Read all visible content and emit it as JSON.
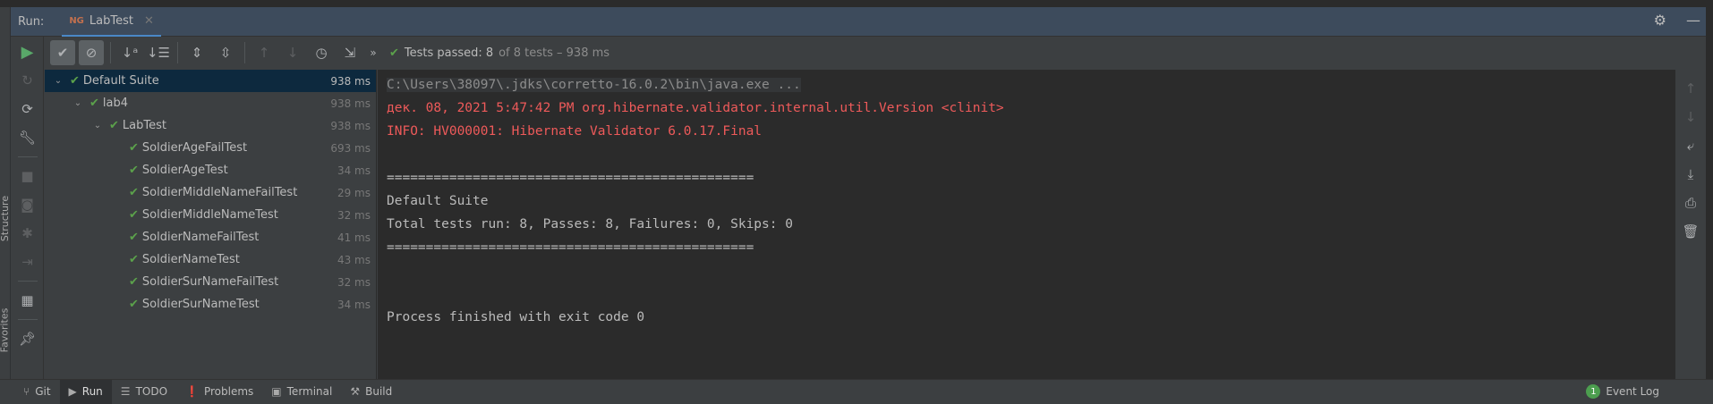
{
  "tabbar": {
    "run_label": "Run:",
    "tab_icon": "NG",
    "tab_label": "LabTest"
  },
  "toolbar": {
    "status_prefix": "Tests passed:",
    "passed": "8",
    "status_suffix": "of 8 tests – 938 ms"
  },
  "side_labels": {
    "structure": "Structure",
    "favorites": "Favorites"
  },
  "tree": [
    {
      "label": "Default Suite",
      "time": "938 ms",
      "level": 0,
      "expanded": true,
      "selected": true
    },
    {
      "label": "lab4",
      "time": "938 ms",
      "level": 1,
      "expanded": true
    },
    {
      "label": "LabTest",
      "time": "938 ms",
      "level": 2,
      "expanded": true
    },
    {
      "label": "SoldierAgeFailTest",
      "time": "693 ms",
      "level": 3
    },
    {
      "label": "SoldierAgeTest",
      "time": "34 ms",
      "level": 3
    },
    {
      "label": "SoldierMiddleNameFailTest",
      "time": "29 ms",
      "level": 3
    },
    {
      "label": "SoldierMiddleNameTest",
      "time": "32 ms",
      "level": 3
    },
    {
      "label": "SoldierNameFailTest",
      "time": "41 ms",
      "level": 3
    },
    {
      "label": "SoldierNameTest",
      "time": "43 ms",
      "level": 3
    },
    {
      "label": "SoldierSurNameFailTest",
      "time": "32 ms",
      "level": 3
    },
    {
      "label": "SoldierSurNameTest",
      "time": "34 ms",
      "level": 3
    }
  ],
  "console": [
    {
      "text": "C:\\Users\\38097\\.jdks\\corretto-16.0.2\\bin\\java.exe ...",
      "kind": "cmd"
    },
    {
      "text": "дек. 08, 2021 5:47:42 PM org.hibernate.validator.internal.util.Version <clinit>",
      "kind": "err"
    },
    {
      "text": "INFO: HV000001: Hibernate Validator 6.0.17.Final",
      "kind": "err"
    },
    {
      "text": "",
      "kind": "out"
    },
    {
      "text": "===============================================",
      "kind": "out"
    },
    {
      "text": "Default Suite",
      "kind": "out"
    },
    {
      "text": "Total tests run: 8, Passes: 8, Failures: 0, Skips: 0",
      "kind": "out"
    },
    {
      "text": "===============================================",
      "kind": "out"
    },
    {
      "text": "",
      "kind": "out"
    },
    {
      "text": "",
      "kind": "out"
    },
    {
      "text": "Process finished with exit code 0",
      "kind": "out"
    }
  ],
  "bottombar": {
    "items": [
      "Git",
      "Run",
      "TODO",
      "Problems",
      "Terminal",
      "Build"
    ],
    "active": "Run",
    "event_log": "Event Log",
    "event_count": "1"
  },
  "colors": {
    "pass": "#5ba14b",
    "error": "#ee5a5a",
    "selection": "#0d293e",
    "accent": "#4a88c7"
  }
}
